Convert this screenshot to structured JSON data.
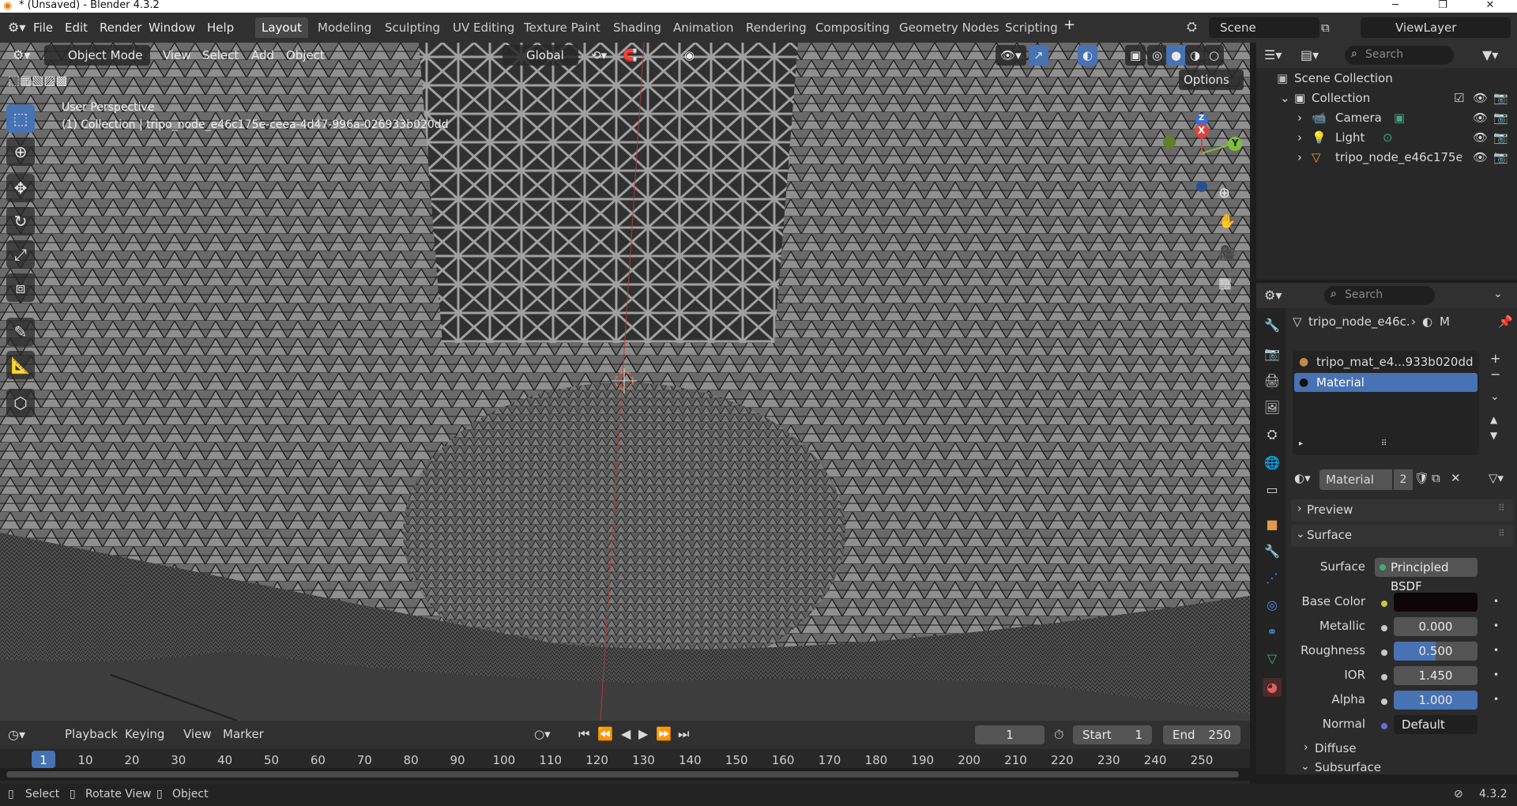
{
  "window": {
    "title": "* (Unsaved) - Blender 4.3.2"
  },
  "menu": {
    "file": "File",
    "edit": "Edit",
    "render": "Render",
    "window": "Window",
    "help": "Help"
  },
  "workspaces": [
    "Layout",
    "Modeling",
    "Sculpting",
    "UV Editing",
    "Texture Paint",
    "Shading",
    "Animation",
    "Rendering",
    "Compositing",
    "Geometry Nodes",
    "Scripting"
  ],
  "scene": {
    "name": "Scene",
    "view_layer": "ViewLayer"
  },
  "viewport_header": {
    "mode": "Object Mode",
    "view": "View",
    "select": "Select",
    "add": "Add",
    "object": "Object",
    "orientation": "Global",
    "options": "Options"
  },
  "viewport_overlay": {
    "perspective": "User Perspective",
    "collection_info": "(1) Collection | tripo_node_e46c175e-ceea-4d47-996a-026933b020dd"
  },
  "gizmo": {
    "x": "X",
    "y": "Y",
    "z": "Z"
  },
  "outliner": {
    "search_placeholder": "Search",
    "scene_collection": "Scene Collection",
    "collection": "Collection",
    "items": [
      {
        "name": "Camera"
      },
      {
        "name": "Light"
      },
      {
        "name": "tripo_node_e46c175e"
      }
    ]
  },
  "properties": {
    "search_placeholder": "Search",
    "breadcrumb_object": "tripo_node_e46c...",
    "breadcrumb_material": "M",
    "slots": [
      "tripo_mat_e4...933b020dd",
      "Material"
    ],
    "material_name": "Material",
    "material_users": "2",
    "panels": {
      "preview": "Preview",
      "surface": "Surface",
      "diffuse": "Diffuse",
      "subsurface": "Subsurface"
    },
    "surface_label": "Surface",
    "surface_value": "Principled BSDF",
    "fields": [
      {
        "label": "Base Color",
        "value": ""
      },
      {
        "label": "Metallic",
        "value": "0.000"
      },
      {
        "label": "Roughness",
        "value": "0.500"
      },
      {
        "label": "IOR",
        "value": "1.450"
      },
      {
        "label": "Alpha",
        "value": "1.000"
      },
      {
        "label": "Normal",
        "value": "Default"
      }
    ],
    "base_color_hex": "#0d0508"
  },
  "timeline": {
    "playback": "Playback",
    "keying": "Keying",
    "view": "View",
    "marker": "Marker",
    "current_frame": "1",
    "start_label": "Start",
    "start": "1",
    "end_label": "End",
    "end": "250",
    "ticks": [
      "1",
      "10",
      "20",
      "30",
      "40",
      "50",
      "60",
      "70",
      "80",
      "90",
      "100",
      "110",
      "120",
      "130",
      "140",
      "150",
      "160",
      "170",
      "180",
      "190",
      "200",
      "210",
      "220",
      "230",
      "240",
      "250"
    ]
  },
  "statusbar": {
    "select": "Select",
    "rotate": "Rotate View",
    "object": "Object",
    "version": "4.3.2"
  },
  "colors": {
    "accent": "#4772b3",
    "header": "#303030",
    "panel": "#2b2b2b"
  }
}
